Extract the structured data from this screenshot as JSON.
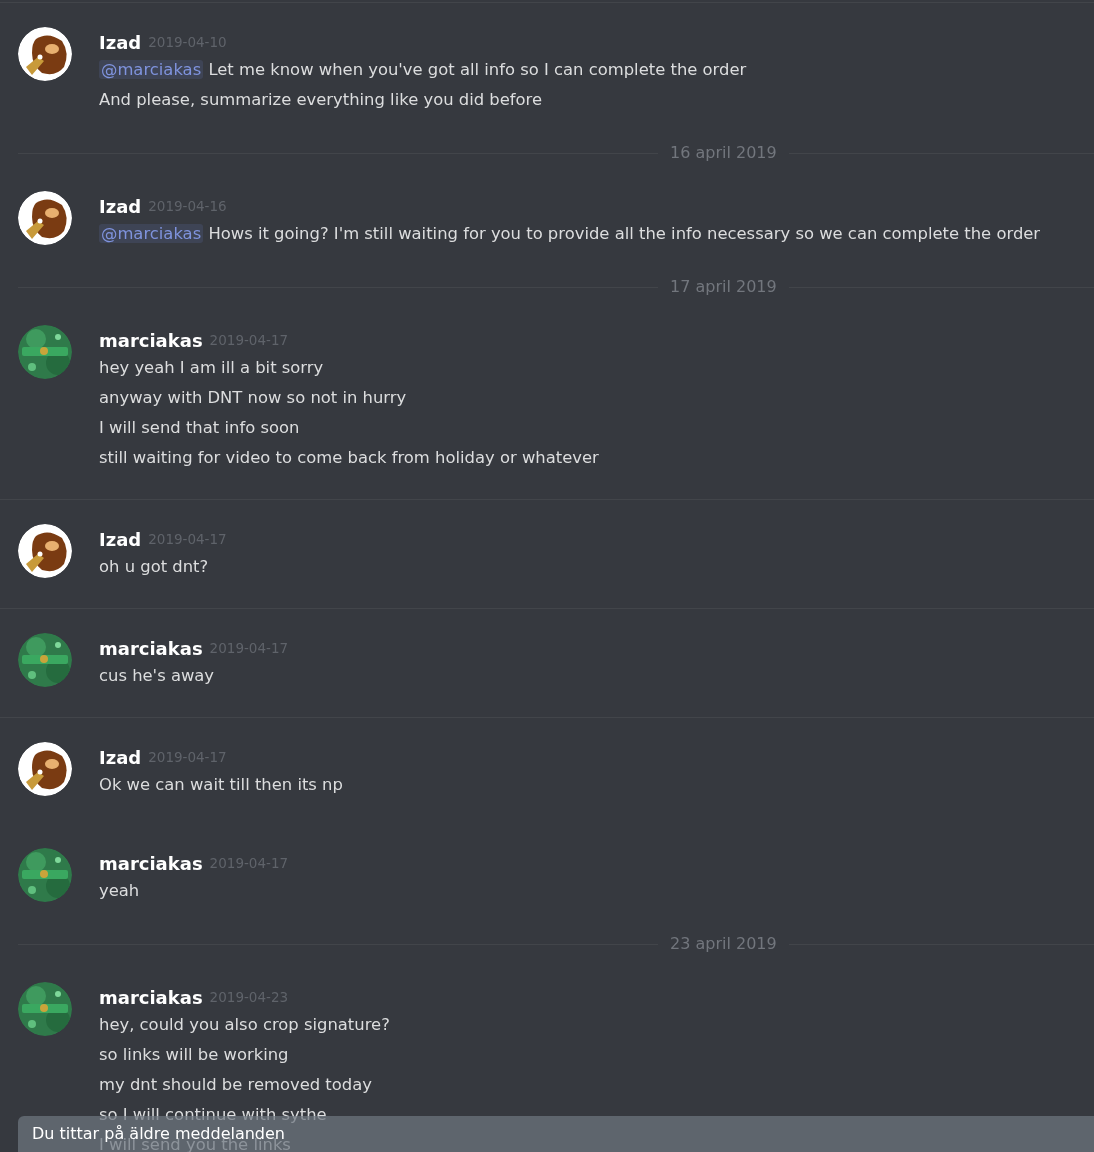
{
  "items": [
    {
      "kind": "divider"
    },
    {
      "kind": "message",
      "author": "Izad",
      "avatar": {
        "kind": "ape"
      },
      "timestamp": "2019-04-10",
      "lines": [
        {
          "mention": "@marciakas",
          "text": "Let me know when you've got all info so I can complete the order"
        },
        {
          "text": "And please, summarize everything like you did before"
        }
      ]
    },
    {
      "kind": "date_divider",
      "label": "16 april 2019"
    },
    {
      "kind": "message",
      "author": "Izad",
      "avatar": {
        "kind": "ape"
      },
      "timestamp": "2019-04-16",
      "lines": [
        {
          "mention": "@marciakas",
          "text": "Hows it going? I'm still waiting for you to provide all the info necessary so we can complete the order"
        }
      ]
    },
    {
      "kind": "date_divider",
      "label": "17 april 2019"
    },
    {
      "kind": "message",
      "author": "marciakas",
      "avatar": {
        "kind": "green"
      },
      "timestamp": "2019-04-17",
      "lines": [
        {
          "text": "hey yeah I am ill a bit sorry"
        },
        {
          "text": "anyway with DNT now so not in hurry"
        },
        {
          "text": "I will send that info soon"
        },
        {
          "text": "still waiting for video to come back from holiday or whatever"
        }
      ]
    },
    {
      "kind": "divider"
    },
    {
      "kind": "message",
      "author": "Izad",
      "avatar": {
        "kind": "ape"
      },
      "timestamp": "2019-04-17",
      "lines": [
        {
          "text": "oh u got dnt?"
        }
      ]
    },
    {
      "kind": "divider"
    },
    {
      "kind": "message",
      "author": "marciakas",
      "avatar": {
        "kind": "green"
      },
      "timestamp": "2019-04-17",
      "lines": [
        {
          "text": "cus he's away"
        }
      ]
    },
    {
      "kind": "divider"
    },
    {
      "kind": "message",
      "author": "Izad",
      "avatar": {
        "kind": "ape"
      },
      "timestamp": "2019-04-17",
      "lines": [
        {
          "text": "Ok we can wait till then its np"
        }
      ]
    },
    {
      "kind": "message",
      "author": "marciakas",
      "avatar": {
        "kind": "green"
      },
      "timestamp": "2019-04-17",
      "lines": [
        {
          "text": "yeah"
        }
      ]
    },
    {
      "kind": "date_divider",
      "label": "23 april 2019"
    },
    {
      "kind": "message",
      "author": "marciakas",
      "avatar": {
        "kind": "green"
      },
      "timestamp": "2019-04-23",
      "lines": [
        {
          "text": "hey, could you also crop signature?"
        },
        {
          "text": "so links will be working"
        },
        {
          "text": "my dnt should be removed today"
        },
        {
          "text": "so I will continue with sythe"
        },
        {
          "text": "I will send you the links"
        }
      ]
    }
  ],
  "notice_bar": {
    "text": "Du tittar på äldre meddelanden"
  }
}
